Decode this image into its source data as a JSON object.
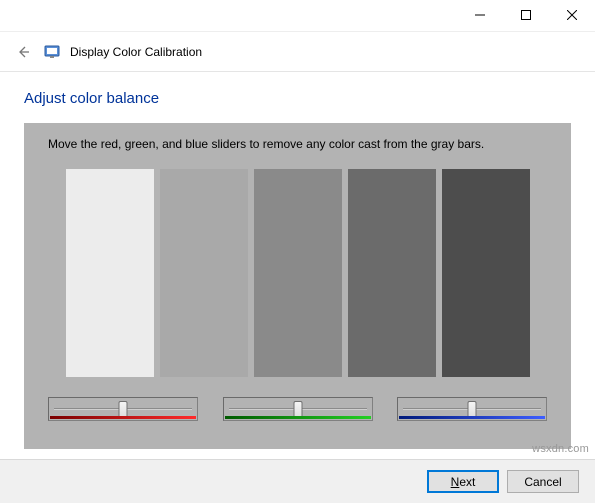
{
  "titlebar": {
    "minimize_icon": "minimize-icon",
    "maximize_icon": "maximize-icon",
    "close_icon": "close-icon"
  },
  "header": {
    "back_icon": "back-arrow-icon",
    "app_title": "Display Color Calibration"
  },
  "page": {
    "heading": "Adjust color balance",
    "instruction": "Move the red, green, and blue sliders to remove any color cast from the gray bars."
  },
  "gray_bars": {
    "colors": [
      "#ececec",
      "#a9a9a9",
      "#8a8a8a",
      "#6b6b6b",
      "#4d4d4d"
    ]
  },
  "sliders": {
    "channels": [
      "red",
      "green",
      "blue"
    ],
    "value_percent": 50
  },
  "buttons": {
    "next_label_pre": "",
    "next_accel": "N",
    "next_label_post": "ext",
    "cancel_label": "Cancel"
  },
  "watermark": "wsxdn.com"
}
